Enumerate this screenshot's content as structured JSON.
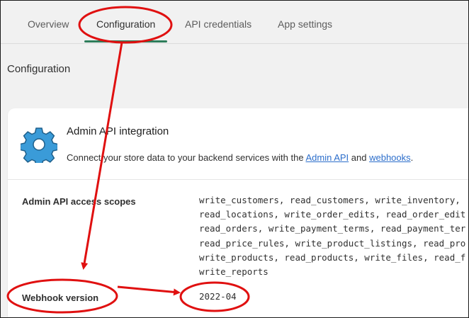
{
  "tabs": [
    {
      "label": "Overview"
    },
    {
      "label": "Configuration"
    },
    {
      "label": "API credentials"
    },
    {
      "label": "App settings"
    }
  ],
  "section_title": "Configuration",
  "card": {
    "title": "Admin API integration",
    "description_prefix": "Connect your store data to your backend services with the ",
    "link_admin_api": "Admin API",
    "description_middle": " and ",
    "link_webhooks": "webhooks",
    "description_suffix": "."
  },
  "scopes_label": "Admin API access scopes",
  "scopes_lines": [
    "write_customers, read_customers, write_inventory,",
    "read_locations, write_order_edits, read_order_edit",
    "read_orders, write_payment_terms, read_payment_ter",
    "read_price_rules, write_product_listings, read_pro",
    "write_products, read_products, write_files, read_f",
    "write_reports"
  ],
  "webhook_label": "Webhook version",
  "webhook_value": "2022-04",
  "colors": {
    "annotation": "#e01010",
    "active_tab_underline": "#2e7d5b",
    "link": "#2c6ecb",
    "gear": "#3a9bd8"
  },
  "icons": {
    "card_icon": "gear-icon"
  }
}
